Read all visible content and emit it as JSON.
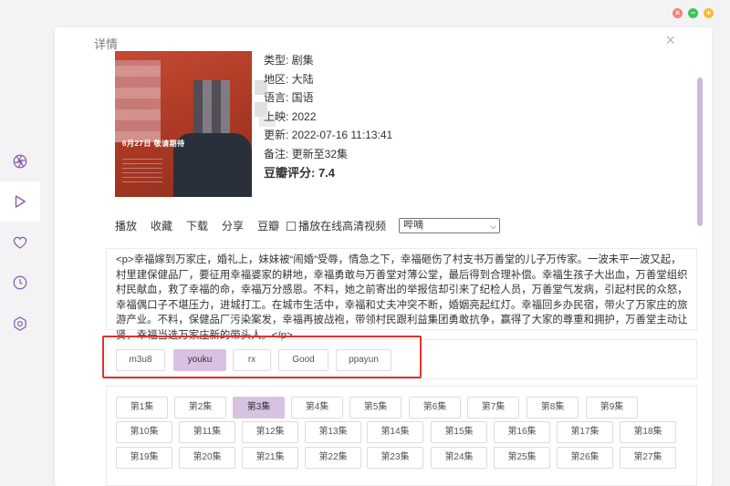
{
  "window": {
    "controls": [
      "close",
      "minimize",
      "maximize"
    ]
  },
  "sidebar": {
    "items": [
      {
        "name": "aperture-icon"
      },
      {
        "name": "play-icon"
      },
      {
        "name": "heart-icon"
      },
      {
        "name": "clock-icon"
      },
      {
        "name": "settings-icon"
      }
    ],
    "active_index": 1
  },
  "dialog": {
    "title": "详情",
    "close": "×"
  },
  "poster": {
    "caption": "6月27日 敬请期待"
  },
  "info": {
    "type": "类型: 剧集",
    "region": "地区: 大陆",
    "language": "语言: 国语",
    "year": "上映: 2022",
    "updated": "更新: 2022-07-16 11:13:41",
    "remark": "备注: 更新至32集",
    "rating": "豆瓣评分: 7.4"
  },
  "actions": {
    "play": "播放",
    "favorite": "收藏",
    "download": "下载",
    "share": "分享",
    "douban": "豆瓣",
    "hd_label": "播放在线高清视频",
    "select_value": "哔嘀"
  },
  "description": "<p>幸福嫁到万家庄，婚礼上，妹妹被“闹婚”受辱，情急之下，幸福砸伤了村支书万善堂的儿子万传家。一波未平一波又起，村里建保健品厂，要征用幸福婆家的耕地，幸福勇敢与万善堂对薄公堂，最后得到合理补偿。幸福生孩子大出血，万善堂组织村民献血，救了幸福的命，幸福万分感恩。不料，她之前寄出的举报信却引来了纪检人员，万善堂气发病，引起村民的众怒，幸福偶口子不堪压力，进城打工。在城市生活中，幸福和丈夫冲突不断，婚姻亮起红灯。幸福回乡办民宿，带火了万家庄的旅游产业。不料，保健品厂污染案发，幸福再披战袍，带领村民跟利益集团勇敢抗争，赢得了大家的尊重和拥护，万善堂主动让贤，幸福当选万家庄新的带头人。</p>",
  "sources": {
    "items": [
      "m3u8",
      "youku",
      "rx",
      "Good",
      "ppayun"
    ],
    "active_index": 1
  },
  "episodes": {
    "items": [
      "第1集",
      "第2集",
      "第3集",
      "第4集",
      "第5集",
      "第6集",
      "第7集",
      "第8集",
      "第9集",
      "第10集",
      "第11集",
      "第12集",
      "第13集",
      "第14集",
      "第15集",
      "第16集",
      "第17集",
      "第18集",
      "第19集",
      "第20集",
      "第21集",
      "第22集",
      "第23集",
      "第24集",
      "第25集",
      "第26集",
      "第27集"
    ],
    "active_index": 2
  },
  "colors": {
    "accent": "#d8c2e2",
    "highlight_border": "#e0322e",
    "sidebar_icon": "#8a5aa8"
  }
}
